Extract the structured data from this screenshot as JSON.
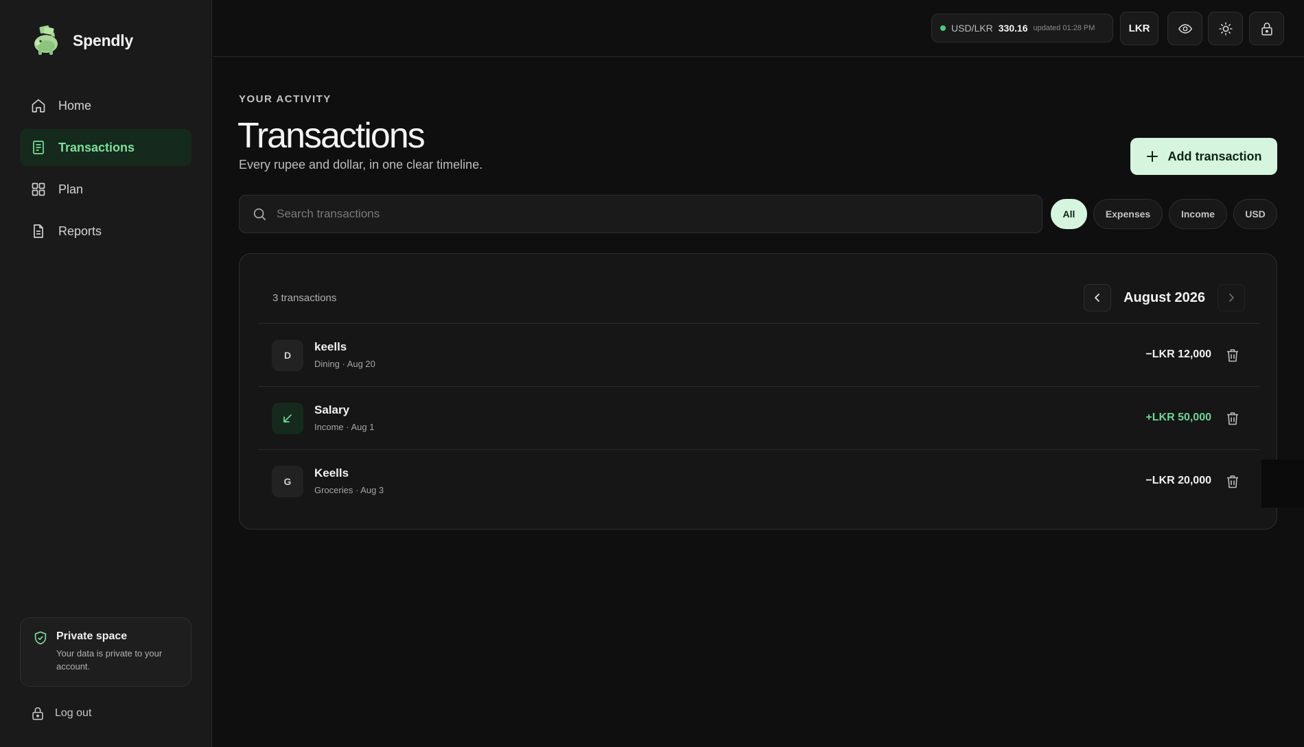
{
  "brand": {
    "name": "Spendly"
  },
  "sidebar": {
    "items": [
      {
        "label": "Home",
        "icon": "home-icon"
      },
      {
        "label": "Transactions",
        "icon": "receipt-icon"
      },
      {
        "label": "Plan",
        "icon": "grid-icon"
      },
      {
        "label": "Reports",
        "icon": "report-icon"
      }
    ],
    "private": {
      "title": "Private space",
      "text": "Your data is private to your account."
    },
    "logout_label": "Log out"
  },
  "topbar": {
    "rate_pair": "USD/LKR",
    "rate_value": "330.16",
    "rate_updated": "updated 01:28 PM",
    "currency_label": "LKR"
  },
  "page": {
    "eyebrow": "YOUR ACTIVITY",
    "title": "Transactions",
    "subtitle": "Every rupee and dollar, in one clear timeline.",
    "add_label": "Add transaction"
  },
  "search": {
    "placeholder": "Search transactions"
  },
  "filters": [
    "All",
    "Expenses",
    "Income",
    "USD"
  ],
  "list": {
    "count": "3 transactions",
    "month": "August 2026",
    "rows": [
      {
        "initial": "D",
        "name": "keells",
        "meta": "Dining · Aug 20",
        "amount": "−LKR 12,000",
        "type": "expense"
      },
      {
        "initial": "",
        "name": "Salary",
        "meta": "Income · Aug 1",
        "amount": "+LKR 50,000",
        "type": "income"
      },
      {
        "initial": "G",
        "name": "Keells",
        "meta": "Groceries · Aug 3",
        "amount": "−LKR 20,000",
        "type": "expense"
      }
    ]
  },
  "colors": {
    "accent": "#7ddf9c",
    "accent_bg": "#d6f5df",
    "income": "#6fd594",
    "background": "#0f0f0f"
  }
}
